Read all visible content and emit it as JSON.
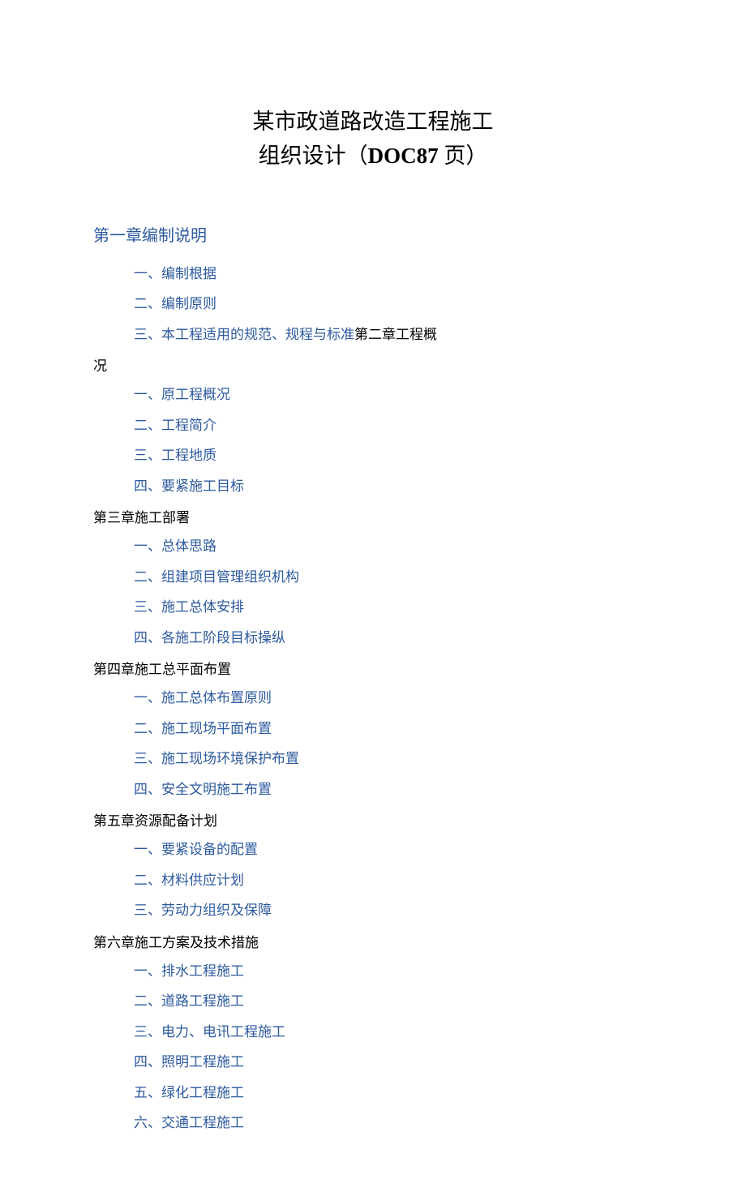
{
  "title": {
    "line1": "某市政道路改造工程施工",
    "line2_prefix": "组织设计（",
    "line2_bold": "DOC87",
    "line2_suffix": " 页）"
  },
  "chapter1": {
    "heading": "第一章编制说明",
    "s1": "一、编制根据",
    "s2": "二、编制原则",
    "s3_link": "三、本工程适用的规范、规程与标准",
    "s3_trail": "第二章工程概"
  },
  "wrap_cont": "况",
  "chapter2_items": {
    "s1": "一、原工程概况",
    "s2": "二、工程简介",
    "s3": "三、工程地质",
    "s4": "四、要紧施工目标"
  },
  "chapter3": {
    "heading": "第三章施工部署",
    "s1": "一、总体思路",
    "s2": "二、组建项目管理组织机构",
    "s3": "三、施工总体安排",
    "s4": "四、各施工阶段目标操纵"
  },
  "chapter4": {
    "heading": "第四章施工总平面布置",
    "s1": "一、施工总体布置原则",
    "s2": "二、施工现场平面布置",
    "s3": "三、施工现场环境保护布置",
    "s4": "四、安全文明施工布置"
  },
  "chapter5": {
    "heading": "第五章资源配备计划",
    "s1": "一、要紧设备的配置",
    "s2": "二、材料供应计划",
    "s3": "三、劳动力组织及保障"
  },
  "chapter6": {
    "heading": "第六章施工方案及技术措施",
    "s1": "一、排水工程施工",
    "s2": "二、道路工程施工",
    "s3": "三、电力、电讯工程施工",
    "s4": "四、照明工程施工",
    "s5": "五、绿化工程施工",
    "s6": "六、交通工程施工"
  }
}
